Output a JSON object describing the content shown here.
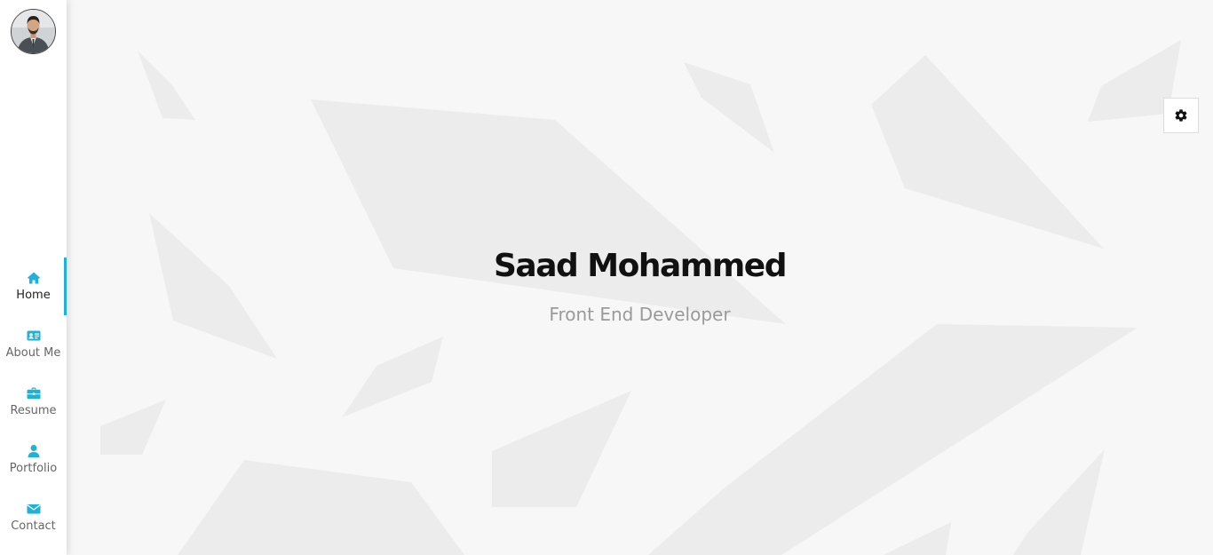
{
  "profile": {
    "name": "Saad Mohammed",
    "role": "Front End Developer"
  },
  "sidebar": {
    "items": [
      {
        "label": "Home",
        "icon": "home-icon",
        "active": true
      },
      {
        "label": "About Me",
        "icon": "id-card-icon",
        "active": false
      },
      {
        "label": "Resume",
        "icon": "briefcase-icon",
        "active": false
      },
      {
        "label": "Portfolio",
        "icon": "user-icon",
        "active": false
      },
      {
        "label": "Contact",
        "icon": "envelope-icon",
        "active": false
      }
    ]
  },
  "settings": {
    "icon": "gear-icon"
  },
  "colors": {
    "accent": "#1fb1d9",
    "background": "#f7f7f7",
    "shapes": "#ececec"
  }
}
